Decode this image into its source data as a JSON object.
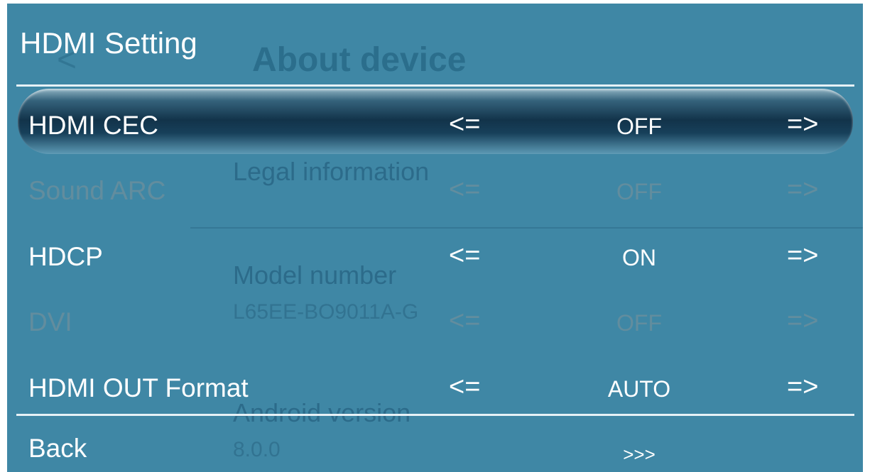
{
  "title": "HDMI Setting",
  "background_screen": {
    "title": "About device",
    "items": [
      {
        "label": "Legal information"
      },
      {
        "label": "Model number",
        "value": "L65EE-BO9011A-G"
      },
      {
        "label": "Android version",
        "value": "8.0.0"
      }
    ]
  },
  "nav": {
    "left": "<=",
    "right": "=>"
  },
  "rows": [
    {
      "label": "HDMI CEC",
      "value": "OFF"
    },
    {
      "label": "Sound ARC",
      "value": "OFF"
    },
    {
      "label": "HDCP",
      "value": "ON"
    },
    {
      "label": "DVI",
      "value": "OFF"
    },
    {
      "label": "HDMI OUT Format",
      "value": "AUTO"
    }
  ],
  "back": {
    "label": "Back",
    "arrows": ">>>"
  },
  "colors": {
    "panel": "#3f87a5",
    "disabled_text": "#6e8f9c",
    "text": "#ffffff"
  }
}
